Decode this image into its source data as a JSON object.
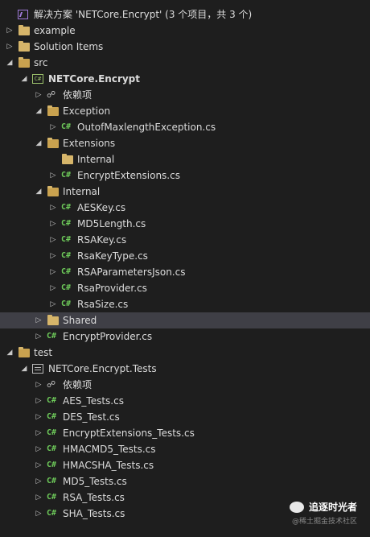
{
  "tree": [
    {
      "label": "解决方案 'NETCore.Encrypt' (3 个项目，共 3 个)",
      "icon": "solution-icon",
      "arrow": "",
      "depth": 0,
      "bold": false
    },
    {
      "label": "example",
      "icon": "folder-icon",
      "arrow": "collapsed",
      "depth": 0,
      "bold": false
    },
    {
      "label": "Solution Items",
      "icon": "folder-icon",
      "arrow": "collapsed",
      "depth": 0,
      "bold": false
    },
    {
      "label": "src",
      "icon": "folder-open-icon",
      "arrow": "expanded",
      "depth": 0,
      "bold": false
    },
    {
      "label": "NETCore.Encrypt",
      "icon": "csharp-project-icon",
      "arrow": "expanded",
      "depth": 1,
      "bold": true
    },
    {
      "label": "依赖项",
      "icon": "dependencies-icon",
      "arrow": "collapsed",
      "depth": 2,
      "bold": false
    },
    {
      "label": "Exception",
      "icon": "folder-open-icon",
      "arrow": "expanded",
      "depth": 2,
      "bold": false
    },
    {
      "label": "OutofMaxlengthException.cs",
      "icon": "csharp-file-icon",
      "arrow": "collapsed",
      "depth": 3,
      "bold": false
    },
    {
      "label": "Extensions",
      "icon": "folder-open-icon",
      "arrow": "expanded",
      "depth": 2,
      "bold": false
    },
    {
      "label": "Internal",
      "icon": "folder-icon",
      "arrow": "",
      "depth": 3,
      "bold": false
    },
    {
      "label": "EncryptExtensions.cs",
      "icon": "csharp-file-icon",
      "arrow": "collapsed",
      "depth": 3,
      "bold": false
    },
    {
      "label": "Internal",
      "icon": "folder-open-icon",
      "arrow": "expanded",
      "depth": 2,
      "bold": false
    },
    {
      "label": "AESKey.cs",
      "icon": "csharp-file-icon",
      "arrow": "collapsed",
      "depth": 3,
      "bold": false
    },
    {
      "label": "MD5Length.cs",
      "icon": "csharp-file-icon",
      "arrow": "collapsed",
      "depth": 3,
      "bold": false
    },
    {
      "label": "RSAKey.cs",
      "icon": "csharp-file-icon",
      "arrow": "collapsed",
      "depth": 3,
      "bold": false
    },
    {
      "label": "RsaKeyType.cs",
      "icon": "csharp-file-icon",
      "arrow": "collapsed",
      "depth": 3,
      "bold": false
    },
    {
      "label": "RSAParametersJson.cs",
      "icon": "csharp-file-icon",
      "arrow": "collapsed",
      "depth": 3,
      "bold": false
    },
    {
      "label": "RsaProvider.cs",
      "icon": "csharp-file-icon",
      "arrow": "collapsed",
      "depth": 3,
      "bold": false
    },
    {
      "label": "RsaSize.cs",
      "icon": "csharp-file-icon",
      "arrow": "collapsed",
      "depth": 3,
      "bold": false
    },
    {
      "label": "Shared",
      "icon": "folder-icon",
      "arrow": "collapsed",
      "depth": 2,
      "bold": false,
      "selected": true
    },
    {
      "label": "EncryptProvider.cs",
      "icon": "csharp-file-icon",
      "arrow": "collapsed",
      "depth": 2,
      "bold": false
    },
    {
      "label": "test",
      "icon": "folder-open-icon",
      "arrow": "expanded",
      "depth": 0,
      "bold": false
    },
    {
      "label": "NETCore.Encrypt.Tests",
      "icon": "test-project-icon",
      "arrow": "expanded",
      "depth": 1,
      "bold": false
    },
    {
      "label": "依赖项",
      "icon": "dependencies-icon",
      "arrow": "collapsed",
      "depth": 2,
      "bold": false
    },
    {
      "label": "AES_Tests.cs",
      "icon": "csharp-file-icon",
      "arrow": "collapsed",
      "depth": 2,
      "bold": false
    },
    {
      "label": "DES_Test.cs",
      "icon": "csharp-file-icon",
      "arrow": "collapsed",
      "depth": 2,
      "bold": false
    },
    {
      "label": "EncryptExtensions_Tests.cs",
      "icon": "csharp-file-icon",
      "arrow": "collapsed",
      "depth": 2,
      "bold": false
    },
    {
      "label": "HMACMD5_Tests.cs",
      "icon": "csharp-file-icon",
      "arrow": "collapsed",
      "depth": 2,
      "bold": false
    },
    {
      "label": "HMACSHA_Tests.cs",
      "icon": "csharp-file-icon",
      "arrow": "collapsed",
      "depth": 2,
      "bold": false
    },
    {
      "label": "MD5_Tests.cs",
      "icon": "csharp-file-icon",
      "arrow": "collapsed",
      "depth": 2,
      "bold": false
    },
    {
      "label": "RSA_Tests.cs",
      "icon": "csharp-file-icon",
      "arrow": "collapsed",
      "depth": 2,
      "bold": false
    },
    {
      "label": "SHA_Tests.cs",
      "icon": "csharp-file-icon",
      "arrow": "collapsed",
      "depth": 2,
      "bold": false
    }
  ],
  "watermark": {
    "title": "追逐时光者",
    "subtitle": "@稀土掘金技术社区"
  }
}
